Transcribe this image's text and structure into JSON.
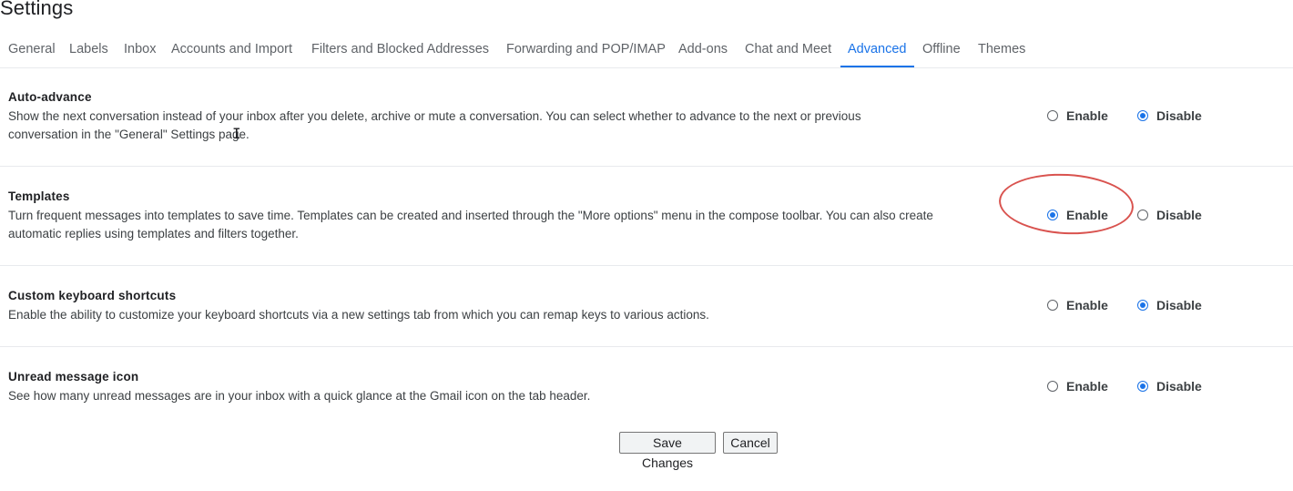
{
  "page": {
    "title": "Settings"
  },
  "tabs": [
    {
      "label": "General",
      "active": false
    },
    {
      "label": "Labels",
      "active": false
    },
    {
      "label": "Inbox",
      "active": false
    },
    {
      "label": "Accounts and Import",
      "active": false
    },
    {
      "label": "Filters and Blocked Addresses",
      "active": false
    },
    {
      "label": "Forwarding and POP/IMAP",
      "active": false
    },
    {
      "label": "Add-ons",
      "active": false
    },
    {
      "label": "Chat and Meet",
      "active": false
    },
    {
      "label": "Advanced",
      "active": true
    },
    {
      "label": "Offline",
      "active": false
    },
    {
      "label": "Themes",
      "active": false
    }
  ],
  "settings": [
    {
      "title": "Auto-advance",
      "description": "Show the next conversation instead of your inbox after you delete, archive or mute a conversation. You can select whether to advance to the next or previous conversation in the \"General\" Settings page.",
      "enable_label": "Enable",
      "disable_label": "Disable",
      "selected": "Disable"
    },
    {
      "title": "Templates",
      "description": "Turn frequent messages into templates to save time. Templates can be created and inserted through the \"More options\" menu in the compose toolbar. You can also create automatic replies using templates and filters together.",
      "enable_label": "Enable",
      "disable_label": "Disable",
      "selected": "Enable"
    },
    {
      "title": "Custom keyboard shortcuts",
      "description": "Enable the ability to customize your keyboard shortcuts via a new settings tab from which you can remap keys to various actions.",
      "enable_label": "Enable",
      "disable_label": "Disable",
      "selected": "Disable"
    },
    {
      "title": "Unread message icon",
      "description": "See how many unread messages are in your inbox with a quick glance at the Gmail icon on the tab header.",
      "enable_label": "Enable",
      "disable_label": "Disable",
      "selected": "Disable"
    }
  ],
  "actions": {
    "save_label": "Save Changes",
    "cancel_label": "Cancel"
  },
  "colors": {
    "accent": "#1a73e8",
    "annotation": "#d9534f",
    "divider": "#e8eaed"
  }
}
